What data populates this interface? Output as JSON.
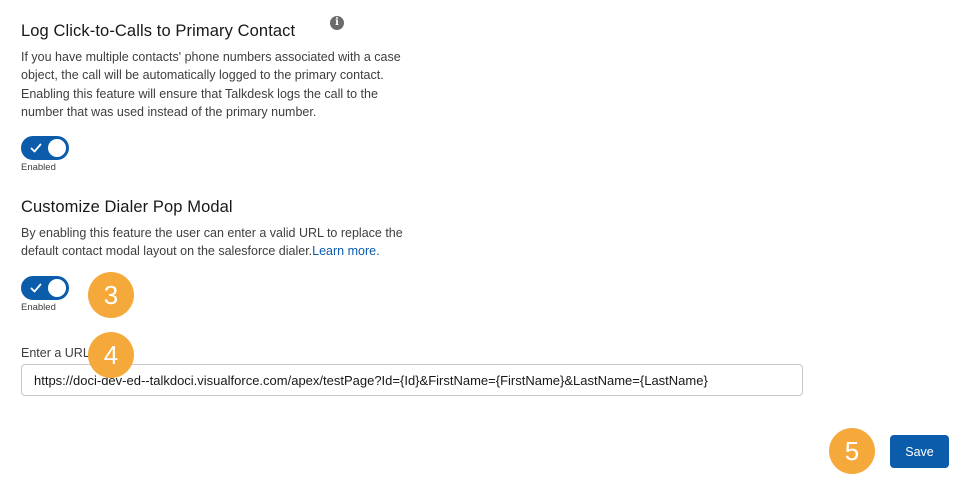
{
  "log_click_to_calls": {
    "title": "Log Click-to-Calls to Primary Contact",
    "info_icon": "i",
    "description": "If you have multiple contacts' phone numbers associated with a case object, the call will be automatically logged to the primary contact. Enabling this feature will ensure that Talkdesk logs the call to the number that was used instead of the primary number.",
    "toggle_state": "Enabled",
    "enabled": true
  },
  "customize_dialer": {
    "title": "Customize Dialer Pop Modal",
    "description": "By enabling this feature the user can enter a valid URL to replace the default contact modal layout on the salesforce dialer.",
    "learn_more": "Learn more.",
    "toggle_state": "Enabled",
    "enabled": true
  },
  "url_field": {
    "label": "Enter a URL",
    "value": "https://doci-dev-ed--talkdoci.visualforce.com/apex/testPage?Id={Id}&FirstName={FirstName}&LastName={LastName}"
  },
  "step_badges": [
    "3",
    "4",
    "5"
  ],
  "save_label": "Save",
  "colors": {
    "brand": "#0b5cab",
    "badge": "#f5a93b"
  }
}
